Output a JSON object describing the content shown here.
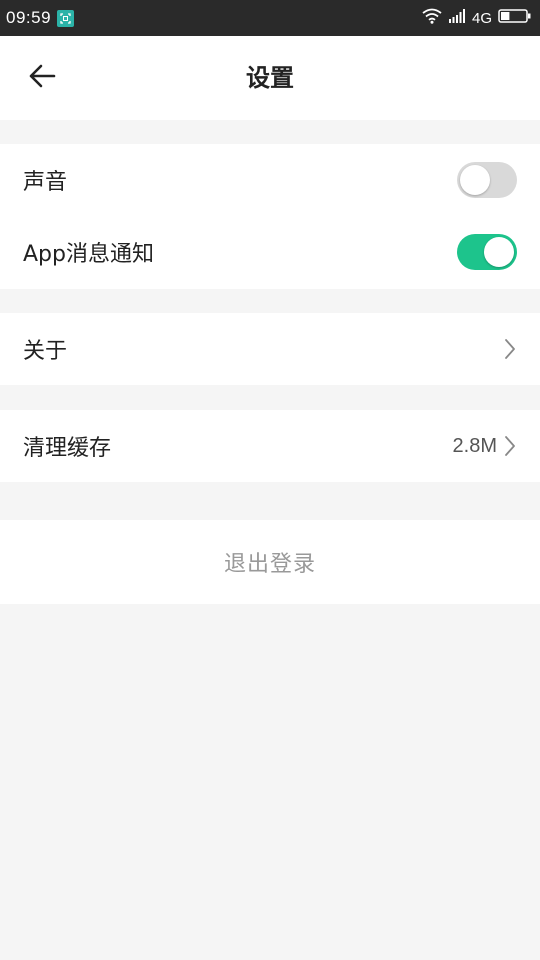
{
  "status_bar": {
    "time": "09:59",
    "network": "4G",
    "icons": [
      "screenshot-icon",
      "wifi-icon",
      "signal-icon",
      "battery-icon"
    ],
    "battery_level": 0.35
  },
  "header": {
    "title": "设置",
    "back_icon": "back-arrow-icon"
  },
  "settings": {
    "sound": {
      "label": "声音",
      "enabled": false
    },
    "app_notify": {
      "label": "App消息通知",
      "enabled": true
    },
    "about": {
      "label": "关于"
    },
    "clear_cache": {
      "label": "清理缓存",
      "value": "2.8M"
    }
  },
  "logout": {
    "label": "退出登录"
  },
  "colors": {
    "accent": "#1dc48c",
    "toggle_off": "#d9d9d9",
    "status_bar": "#2a2a2a",
    "background": "#f5f5f5",
    "logout_text": "#999999"
  }
}
